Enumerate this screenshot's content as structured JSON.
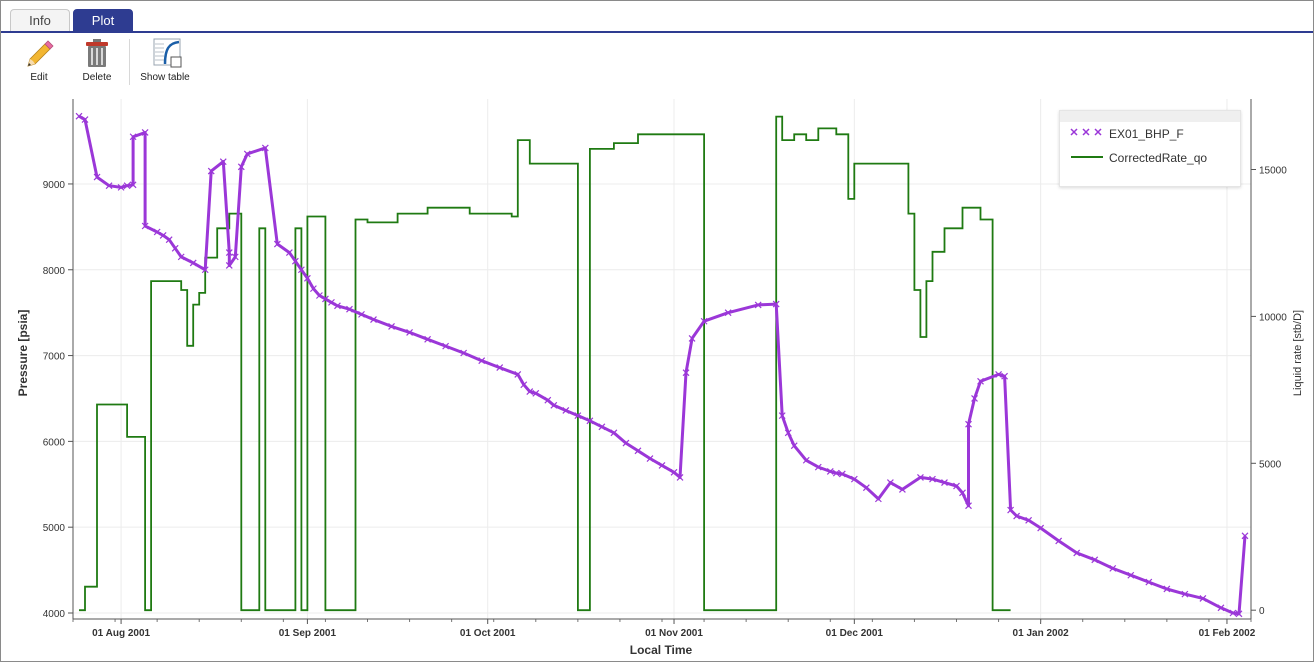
{
  "tabs": [
    {
      "label": "Info",
      "active": false
    },
    {
      "label": "Plot",
      "active": true
    }
  ],
  "toolbar": {
    "edit_label": "Edit",
    "delete_label": "Delete",
    "show_table_label": "Show table"
  },
  "colors": {
    "accent": "#2e3c91",
    "bhp_series": "#9b37d8",
    "rate_series": "#1f7a12"
  },
  "chart_data": {
    "type": "line",
    "xlabel": "Local Time",
    "ylabel": "Pressure [psia]",
    "y2label": "Liquid rate [stb/D]",
    "xlim": [
      "2001-07-24",
      "2002-02-05"
    ],
    "ylim": [
      3930,
      9990
    ],
    "y2lim": [
      -300,
      17400
    ],
    "grid": true,
    "legend_position": "top-right",
    "xticks": [
      {
        "date": "2001-08-01",
        "label": "01 Aug 2001"
      },
      {
        "date": "2001-09-01",
        "label": "01 Sep 2001"
      },
      {
        "date": "2001-10-01",
        "label": "01 Oct 2001"
      },
      {
        "date": "2001-11-01",
        "label": "01 Nov 2001"
      },
      {
        "date": "2001-12-01",
        "label": "01 Dec 2001"
      },
      {
        "date": "2002-01-01",
        "label": "01 Jan 2002"
      },
      {
        "date": "2002-02-01",
        "label": "01 Feb 2002"
      }
    ],
    "yticks": [
      {
        "value": 4000,
        "label": "4000"
      },
      {
        "value": 5000,
        "label": "5000"
      },
      {
        "value": 6000,
        "label": "6000"
      },
      {
        "value": 7000,
        "label": "7000"
      },
      {
        "value": 8000,
        "label": "8000"
      },
      {
        "value": 9000,
        "label": "9000"
      }
    ],
    "y2ticks": [
      {
        "value": 0,
        "label": "0"
      },
      {
        "value": 5000,
        "label": "5000"
      },
      {
        "value": 10000,
        "label": "10000"
      },
      {
        "value": 15000,
        "label": "15000"
      }
    ],
    "series": [
      {
        "name": "EX01_BHP_F",
        "axis": "left",
        "style": "markers-x",
        "x": [
          "2001-07-25",
          "2001-07-26",
          "2001-07-28",
          "2001-07-30",
          "2001-08-01",
          "2001-08-02",
          "2001-08-03",
          "2001-08-03",
          "2001-08-05",
          "2001-08-05",
          "2001-08-07",
          "2001-08-08",
          "2001-08-09",
          "2001-08-10",
          "2001-08-11",
          "2001-08-13",
          "2001-08-15",
          "2001-08-16",
          "2001-08-18",
          "2001-08-19",
          "2001-08-19",
          "2001-08-20",
          "2001-08-21",
          "2001-08-22",
          "2001-08-25",
          "2001-08-27",
          "2001-08-29",
          "2001-08-30",
          "2001-08-31",
          "2001-09-01",
          "2001-09-02",
          "2001-09-03",
          "2001-09-04",
          "2001-09-05",
          "2001-09-06",
          "2001-09-08",
          "2001-09-10",
          "2001-09-12",
          "2001-09-15",
          "2001-09-18",
          "2001-09-21",
          "2001-09-24",
          "2001-09-27",
          "2001-09-30",
          "2001-10-03",
          "2001-10-06",
          "2001-10-07",
          "2001-10-08",
          "2001-10-09",
          "2001-10-11",
          "2001-10-12",
          "2001-10-14",
          "2001-10-16",
          "2001-10-18",
          "2001-10-20",
          "2001-10-22",
          "2001-10-24",
          "2001-10-26",
          "2001-10-28",
          "2001-10-30",
          "2001-11-01",
          "2001-11-02",
          "2001-11-03",
          "2001-11-04",
          "2001-11-06",
          "2001-11-10",
          "2001-11-15",
          "2001-11-18",
          "2001-11-19",
          "2001-11-20",
          "2001-11-21",
          "2001-11-23",
          "2001-11-25",
          "2001-11-27",
          "2001-11-28",
          "2001-11-29",
          "2001-12-01",
          "2001-12-03",
          "2001-12-05",
          "2001-12-07",
          "2001-12-09",
          "2001-12-12",
          "2001-12-14",
          "2001-12-16",
          "2001-12-18",
          "2001-12-19",
          "2001-12-20",
          "2001-12-20",
          "2001-12-21",
          "2001-12-22",
          "2001-12-25",
          "2001-12-26",
          "2001-12-27",
          "2001-12-28",
          "2001-12-30",
          "2002-01-01",
          "2002-01-04",
          "2002-01-07",
          "2002-01-10",
          "2002-01-13",
          "2002-01-16",
          "2002-01-19",
          "2002-01-22",
          "2002-01-25",
          "2002-01-28",
          "2002-01-31",
          "2002-02-02",
          "2002-02-03",
          "2002-02-04"
        ],
        "y": [
          9790,
          9750,
          9080,
          8980,
          8960,
          8980,
          8990,
          9550,
          9600,
          8510,
          8440,
          8400,
          8350,
          8250,
          8150,
          8080,
          8000,
          9150,
          9260,
          8200,
          8050,
          8150,
          9200,
          9350,
          9420,
          8300,
          8200,
          8100,
          8000,
          7900,
          7780,
          7700,
          7660,
          7620,
          7580,
          7540,
          7480,
          7420,
          7340,
          7270,
          7190,
          7110,
          7030,
          6940,
          6860,
          6780,
          6660,
          6580,
          6560,
          6480,
          6420,
          6360,
          6300,
          6240,
          6170,
          6100,
          5980,
          5890,
          5800,
          5720,
          5640,
          5580,
          6800,
          7200,
          7400,
          7500,
          7590,
          7600,
          6300,
          6100,
          5950,
          5780,
          5700,
          5650,
          5630,
          5620,
          5560,
          5460,
          5330,
          5520,
          5440,
          5580,
          5560,
          5520,
          5480,
          5400,
          5250,
          6200,
          6500,
          6700,
          6780,
          6760,
          5200,
          5130,
          5080,
          4990,
          4840,
          4700,
          4620,
          4520,
          4440,
          4360,
          4280,
          4220,
          4170,
          4060,
          4000,
          3990,
          4900
        ]
      },
      {
        "name": "CorrectedRate_qo",
        "axis": "right",
        "style": "step-line",
        "x": [
          "2001-07-25",
          "2001-07-26",
          "2001-07-28",
          "2001-07-29",
          "2001-08-02",
          "2001-08-05",
          "2001-08-06",
          "2001-08-11",
          "2001-08-12",
          "2001-08-13",
          "2001-08-14",
          "2001-08-15",
          "2001-08-17",
          "2001-08-19",
          "2001-08-21",
          "2001-08-24",
          "2001-08-25",
          "2001-08-30",
          "2001-08-31",
          "2001-09-01",
          "2001-09-03",
          "2001-09-04",
          "2001-09-09",
          "2001-09-11",
          "2001-09-16",
          "2001-09-21",
          "2001-09-28",
          "2001-10-05",
          "2001-10-06",
          "2001-10-08",
          "2001-10-10",
          "2001-10-16",
          "2001-10-18",
          "2001-10-20",
          "2001-10-22",
          "2001-10-26",
          "2001-10-28",
          "2001-11-01",
          "2001-11-05",
          "2001-11-06",
          "2001-11-15",
          "2001-11-18",
          "2001-11-19",
          "2001-11-21",
          "2001-11-23",
          "2001-11-25",
          "2001-11-28",
          "2001-11-30",
          "2001-12-01",
          "2001-12-09",
          "2001-12-10",
          "2001-12-11",
          "2001-12-12",
          "2001-12-13",
          "2001-12-14",
          "2001-12-16",
          "2001-12-18",
          "2001-12-19",
          "2001-12-20",
          "2001-12-22",
          "2001-12-24",
          "2001-12-25",
          "2001-12-26",
          "2001-12-27"
        ],
        "y": [
          0,
          800,
          7000,
          7000,
          5900,
          0,
          11200,
          10900,
          9000,
          10400,
          10800,
          12000,
          13000,
          13500,
          0,
          13000,
          0,
          13000,
          0,
          13400,
          13400,
          0,
          13300,
          13200,
          13500,
          13700,
          13500,
          13400,
          16000,
          15200,
          15200,
          0,
          15700,
          15700,
          15900,
          16200,
          16200,
          16200,
          16200,
          0,
          0,
          16800,
          16000,
          16200,
          16000,
          16400,
          16200,
          14000,
          15200,
          15200,
          13500,
          10900,
          9300,
          11200,
          12200,
          13000,
          13000,
          13700,
          13700,
          13300,
          0,
          0,
          0,
          0
        ]
      }
    ]
  }
}
